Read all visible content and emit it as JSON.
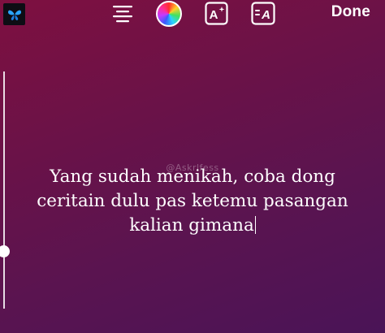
{
  "topbar": {
    "app_icon": "app-icon",
    "align_icon": "align-center-icon",
    "color_icon": "color-picker-icon",
    "effect_icon": "text-effect-icon",
    "effect_label": "A",
    "animate_icon": "text-animate-icon",
    "animate_label": "A",
    "done_label": "Done"
  },
  "watermark": "@Askrlfess",
  "caption": {
    "lines": [
      "Yang sudah menikah, coba dong",
      "ceritain dulu pas ketemu pasangan",
      "kalian gimana"
    ]
  },
  "size_slider": {
    "level": 0.24
  },
  "colors": {
    "background_top": "#7e1040",
    "background_bottom": "#4a1457",
    "text": "#ffffff"
  }
}
